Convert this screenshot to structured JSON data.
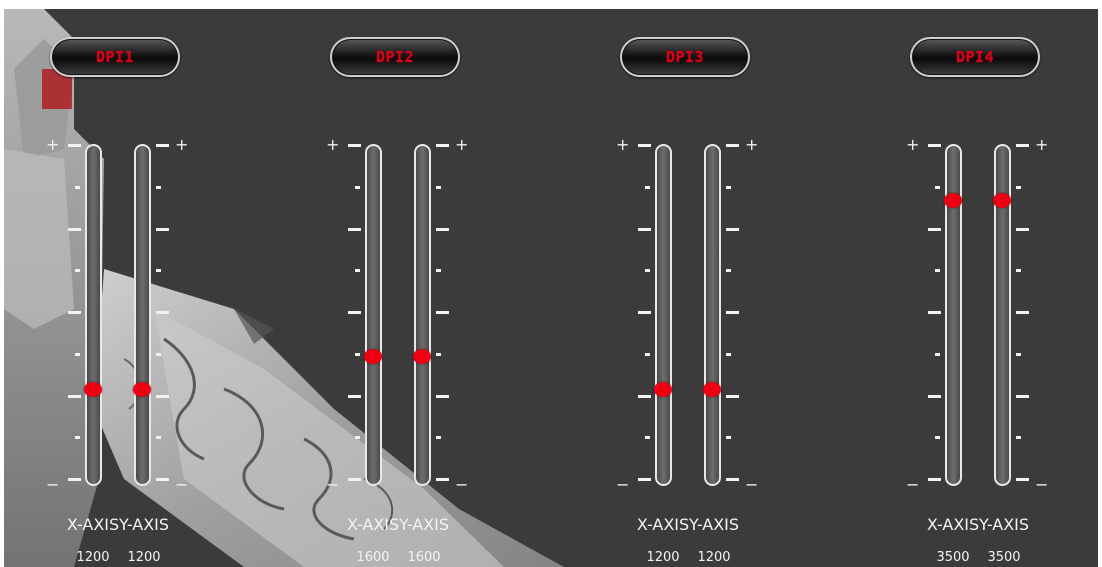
{
  "scale": {
    "min": 200,
    "max": 4000
  },
  "groups": [
    {
      "title": "DPI1",
      "x_label": "X-AXIS",
      "y_label": "Y-AXIS",
      "x_value": "1200",
      "y_value": "1200"
    },
    {
      "title": "DPI2",
      "x_label": "X-AXIS",
      "y_label": "Y-AXIS",
      "x_value": "1600",
      "y_value": "1600"
    },
    {
      "title": "DPI3",
      "x_label": "X-AXIS",
      "y_label": "Y-AXIS",
      "x_value": "1200",
      "y_value": "1200"
    },
    {
      "title": "DPI4",
      "x_label": "X-AXIS",
      "y_label": "Y-AXIS",
      "x_value": "3500",
      "y_value": "3500"
    }
  ],
  "signs": {
    "plus": "+",
    "minus": "−"
  },
  "colors": {
    "accent": "#ee0012",
    "background": "#3b3b3b",
    "track_border": "#e8e8e8"
  }
}
